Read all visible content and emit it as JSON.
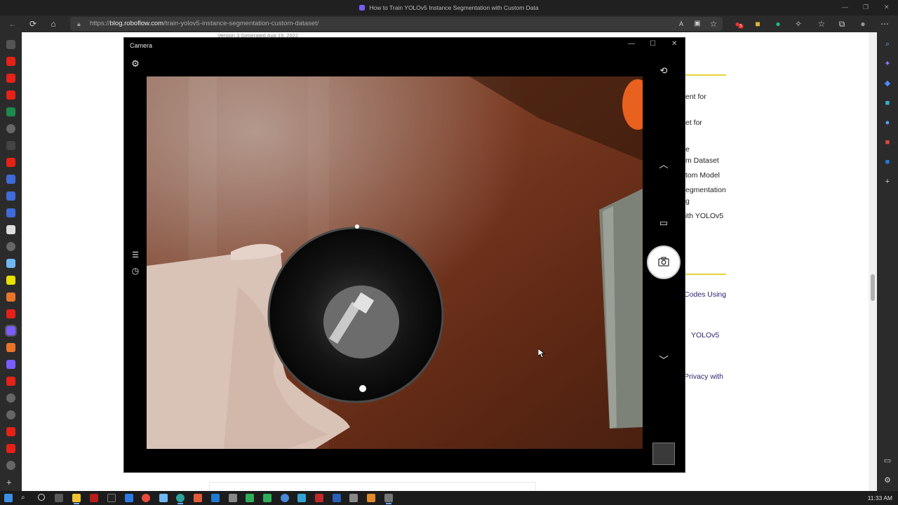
{
  "browser": {
    "tab_title": "How to Train YOLOv5 Instance Segmentation with Custom Data",
    "url_prefix": "https://",
    "url_domain": "blog.roboflow.com",
    "url_path": "/train-yolov5-instance-segmentation-custom-dataset/",
    "notification_count": "5"
  },
  "page": {
    "version_text": "Version 3 Generated Aug 19, 2022",
    "toc_items": [
      "ent for",
      "et for",
      "e",
      "m Dataset",
      "tom Model",
      "egmentation",
      "g",
      "ith YOLOv5"
    ],
    "related_items": [
      "Codes Using",
      "YOLOv5",
      "Privacy with"
    ]
  },
  "camera": {
    "title": "Camera",
    "colors": {
      "accent": "#ffffff",
      "background": "#000000"
    }
  },
  "taskbar": {
    "time": "11:33 AM"
  }
}
